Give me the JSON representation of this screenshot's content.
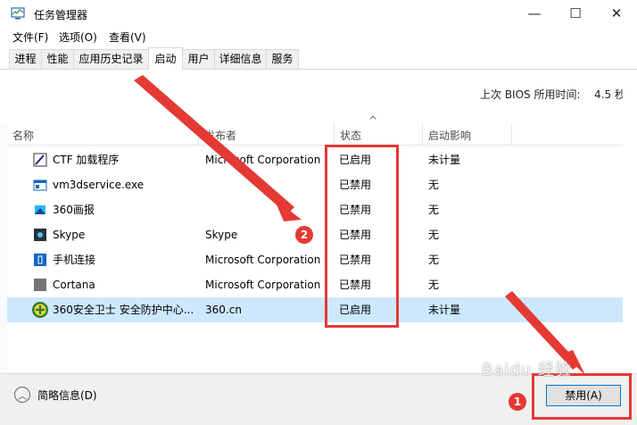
{
  "window": {
    "title": "任务管理器",
    "controls": {
      "minimize": "—",
      "maximize": "☐",
      "close": "✕"
    }
  },
  "menu": [
    "文件(F)",
    "选项(O)",
    "查看(V)"
  ],
  "tabs": [
    {
      "label": "进程",
      "active": false
    },
    {
      "label": "性能",
      "active": false
    },
    {
      "label": "应用历史记录",
      "active": false
    },
    {
      "label": "启动",
      "active": true
    },
    {
      "label": "用户",
      "active": false
    },
    {
      "label": "详细信息",
      "active": false
    },
    {
      "label": "服务",
      "active": false
    }
  ],
  "bios": {
    "label": "上次 BIOS 所用时间:",
    "value": "4.5 秒"
  },
  "table": {
    "sort_indicator": "^",
    "columns": [
      "名称",
      "发布者",
      "状态",
      "启动影响"
    ],
    "rows": [
      {
        "name": "CTF 加载程序",
        "publisher": "Microsoft Corporation",
        "status": "已启用",
        "impact": "未计量",
        "icon": "ctf-loader-icon",
        "selected": false
      },
      {
        "name": "vm3dservice.exe",
        "publisher": "",
        "status": "已禁用",
        "impact": "无",
        "icon": "vm3dservice-icon",
        "selected": false
      },
      {
        "name": "360画报",
        "publisher": "",
        "status": "已禁用",
        "impact": "无",
        "icon": "360-huabao-icon",
        "selected": false
      },
      {
        "name": "Skype",
        "publisher": "Skype",
        "status": "已禁用",
        "impact": "无",
        "icon": "skype-icon",
        "selected": false
      },
      {
        "name": "手机连接",
        "publisher": "Microsoft Corporation",
        "status": "已禁用",
        "impact": "无",
        "icon": "phone-link-icon",
        "selected": false
      },
      {
        "name": "Cortana",
        "publisher": "Microsoft Corporation",
        "status": "已禁用",
        "impact": "无",
        "icon": "cortana-icon",
        "selected": false
      },
      {
        "name": "360安全卫士 安全防护中心...",
        "publisher": "360.cn",
        "status": "已启用",
        "impact": "未计量",
        "icon": "360-safe-icon",
        "selected": true
      }
    ]
  },
  "footer": {
    "less_info": "简略信息(D)",
    "disable_button": "禁用(A)"
  },
  "annotations": {
    "badge_1": "1",
    "badge_2": "2"
  },
  "watermark": "Baidu 经验",
  "colors": {
    "annotation_red": "#e53935",
    "selection_blue": "#cce8ff",
    "button_border": "#0078d7"
  }
}
